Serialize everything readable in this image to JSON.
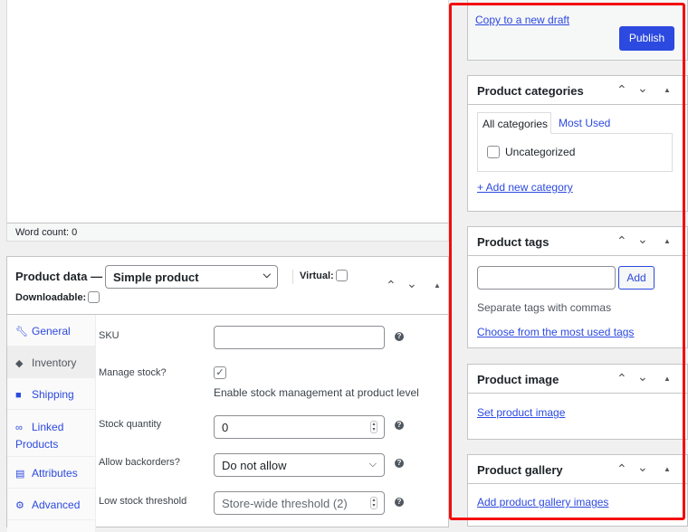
{
  "editor": {
    "word_count_label": "Word count: 0"
  },
  "product_data": {
    "title": "Product data —",
    "type_select": {
      "value": "Simple product"
    },
    "virtual_label": "Virtual:",
    "virtual_checked": false,
    "downloadable_label": "Downloadable:",
    "downloadable_checked": false,
    "tabs": [
      {
        "label": "General",
        "icon": "wrench-icon",
        "active": false
      },
      {
        "label": "Inventory",
        "icon": "tag-icon",
        "active": true
      },
      {
        "label": "Shipping",
        "icon": "truck-icon",
        "active": false
      },
      {
        "label": "Linked Products",
        "label_line1": "Linked",
        "label_line2": "Products",
        "icon": "link-icon",
        "active": false
      },
      {
        "label": "Attributes",
        "icon": "list-icon",
        "active": false
      },
      {
        "label": "Advanced",
        "icon": "gear-icon",
        "active": false
      }
    ],
    "fields": {
      "sku": {
        "label": "SKU",
        "value": ""
      },
      "manage_stock": {
        "label": "Manage stock?",
        "checked": true,
        "description": "Enable stock management at product level"
      },
      "stock_quantity": {
        "label": "Stock quantity",
        "value": "0"
      },
      "backorders": {
        "label": "Allow backorders?",
        "value": "Do not allow"
      },
      "low_stock": {
        "label": "Low stock threshold",
        "placeholder": "Store-wide threshold (2)"
      }
    }
  },
  "sidebar": {
    "publish": {
      "copy_link": "Copy to a new draft",
      "publish_button": "Publish"
    },
    "categories": {
      "title": "Product categories",
      "tab_all": "All categories",
      "tab_most_used": "Most Used",
      "items": [
        {
          "label": "Uncategorized",
          "checked": false
        }
      ],
      "add_link": "+ Add new category"
    },
    "tags": {
      "title": "Product tags",
      "input_value": "",
      "add_button": "Add",
      "hint": "Separate tags with commas",
      "choose_link": "Choose from the most used tags"
    },
    "image": {
      "title": "Product image",
      "set_link": "Set product image"
    },
    "gallery": {
      "title": "Product gallery",
      "add_link": "Add product gallery images"
    }
  },
  "colors": {
    "accent": "#2c49e0",
    "highlight_frame": "#f30b0b"
  }
}
